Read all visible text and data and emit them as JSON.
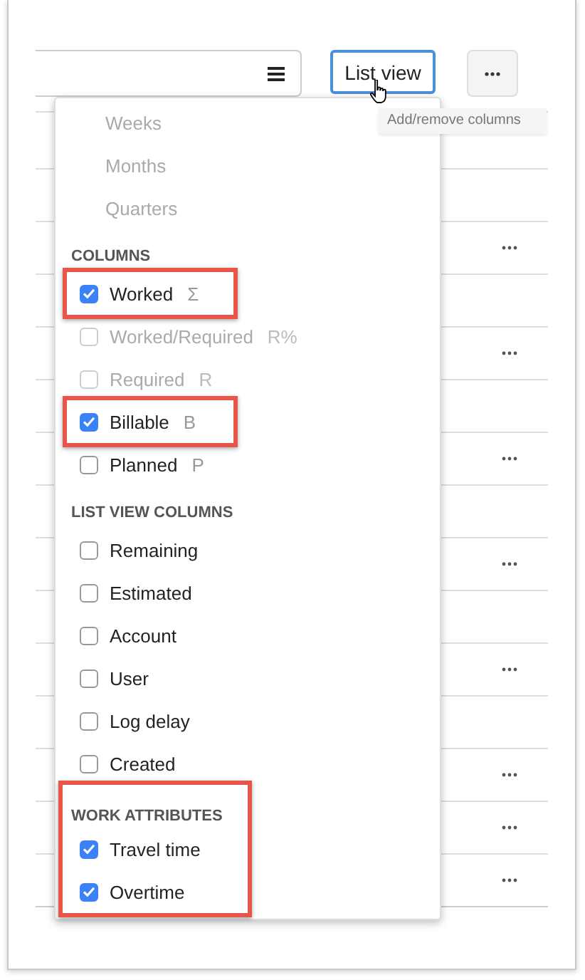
{
  "toolbar": {
    "view_button": {
      "label": "List view",
      "focused": true
    },
    "tooltip": {
      "text": "Add/remove columns"
    }
  },
  "table": {
    "rows": [
      {
        "actions": false
      },
      {
        "actions": false
      },
      {
        "actions": true
      },
      {
        "actions": false
      },
      {
        "actions": true
      },
      {
        "actions": false
      },
      {
        "actions": true
      },
      {
        "actions": false
      },
      {
        "actions": true
      },
      {
        "actions": false
      },
      {
        "actions": true
      },
      {
        "actions": false
      },
      {
        "actions": true
      },
      {
        "actions": true
      },
      {
        "actions": true
      }
    ]
  },
  "menu": {
    "sections": [
      {
        "highlighted": false,
        "items": [
          {
            "kind": "option",
            "label": "Weeks",
            "disabled": true,
            "highlighted": false
          },
          {
            "kind": "option",
            "label": "Months",
            "disabled": true,
            "highlighted": false
          },
          {
            "kind": "option",
            "label": "Quarters",
            "disabled": true,
            "highlighted": false
          }
        ]
      },
      {
        "heading": "COLUMNS",
        "highlighted": false,
        "items": [
          {
            "kind": "checkbox",
            "label": "Worked",
            "shortcut": "Σ",
            "checked": true,
            "disabled": false,
            "highlighted": true
          },
          {
            "kind": "checkbox",
            "label": "Worked/Required",
            "shortcut": "R%",
            "checked": false,
            "disabled": true,
            "highlighted": false
          },
          {
            "kind": "checkbox",
            "label": "Required",
            "shortcut": "R",
            "checked": false,
            "disabled": true,
            "highlighted": false
          },
          {
            "kind": "checkbox",
            "label": "Billable",
            "shortcut": "B",
            "checked": true,
            "disabled": false,
            "highlighted": true
          },
          {
            "kind": "checkbox",
            "label": "Planned",
            "shortcut": "P",
            "checked": false,
            "disabled": false,
            "highlighted": false
          }
        ]
      },
      {
        "heading": "LIST VIEW COLUMNS",
        "highlighted": false,
        "items": [
          {
            "kind": "checkbox",
            "label": "Remaining",
            "checked": false,
            "disabled": false,
            "highlighted": false
          },
          {
            "kind": "checkbox",
            "label": "Estimated",
            "checked": false,
            "disabled": false,
            "highlighted": false
          },
          {
            "kind": "checkbox",
            "label": "Account",
            "checked": false,
            "disabled": false,
            "highlighted": false
          },
          {
            "kind": "checkbox",
            "label": "User",
            "checked": false,
            "disabled": false,
            "highlighted": false
          },
          {
            "kind": "checkbox",
            "label": "Log delay",
            "checked": false,
            "disabled": false,
            "highlighted": false
          },
          {
            "kind": "checkbox",
            "label": "Created",
            "checked": false,
            "disabled": false,
            "highlighted": false
          }
        ]
      },
      {
        "heading": "WORK ATTRIBUTES",
        "highlighted": true,
        "items": [
          {
            "kind": "checkbox",
            "label": "Travel time",
            "checked": true,
            "disabled": false,
            "highlighted": false
          },
          {
            "kind": "checkbox",
            "label": "Overtime",
            "checked": true,
            "disabled": false,
            "highlighted": false
          }
        ]
      }
    ]
  }
}
